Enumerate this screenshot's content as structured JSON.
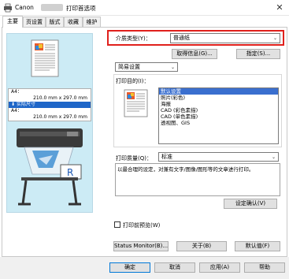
{
  "window": {
    "title_prefix": "Canon",
    "title_suffix": "打印首选项",
    "close_glyph": "✕"
  },
  "tabs": [
    "主要",
    "页设置",
    "版式",
    "收藏",
    "维护"
  ],
  "media": {
    "label": "介质类型(Y)：",
    "value": "普通纸",
    "get_info_button": "取得信息(G)...",
    "specify_button": "指定(S)..."
  },
  "setting_mode": {
    "value": "简易设置"
  },
  "print_target": {
    "label": "打印目的(I)：",
    "items": [
      "默认设置",
      "照片(彩色)",
      "海报",
      "CAD (彩色素描)",
      "CAD (单色素描)",
      "透视图、GIS"
    ],
    "selected_index": 0
  },
  "paper_info": {
    "rows": [
      "A4：",
      "210.0 mm x 297.0 mm",
      "实际尺寸",
      "A4：",
      "210.0 mm x 297.0 mm"
    ],
    "arrow_glyph": "⬇"
  },
  "print_quality": {
    "label": "打印质量(Q)：",
    "value": "标准"
  },
  "description": "以最合理的设定，对兼有文字/图像/图形等的文章进行打印。",
  "confirm_settings_button": "设定确认(V)",
  "preview_checkbox": {
    "label": "打印前预览(W)",
    "checked": false
  },
  "status_monitor_button": "Status Monitor(B)...",
  "about_button": "关于(B)",
  "defaults_button": "默认值(F)",
  "dialog_buttons": {
    "ok": "确定",
    "cancel": "取消",
    "apply": "应用(A)",
    "help": "帮助"
  }
}
